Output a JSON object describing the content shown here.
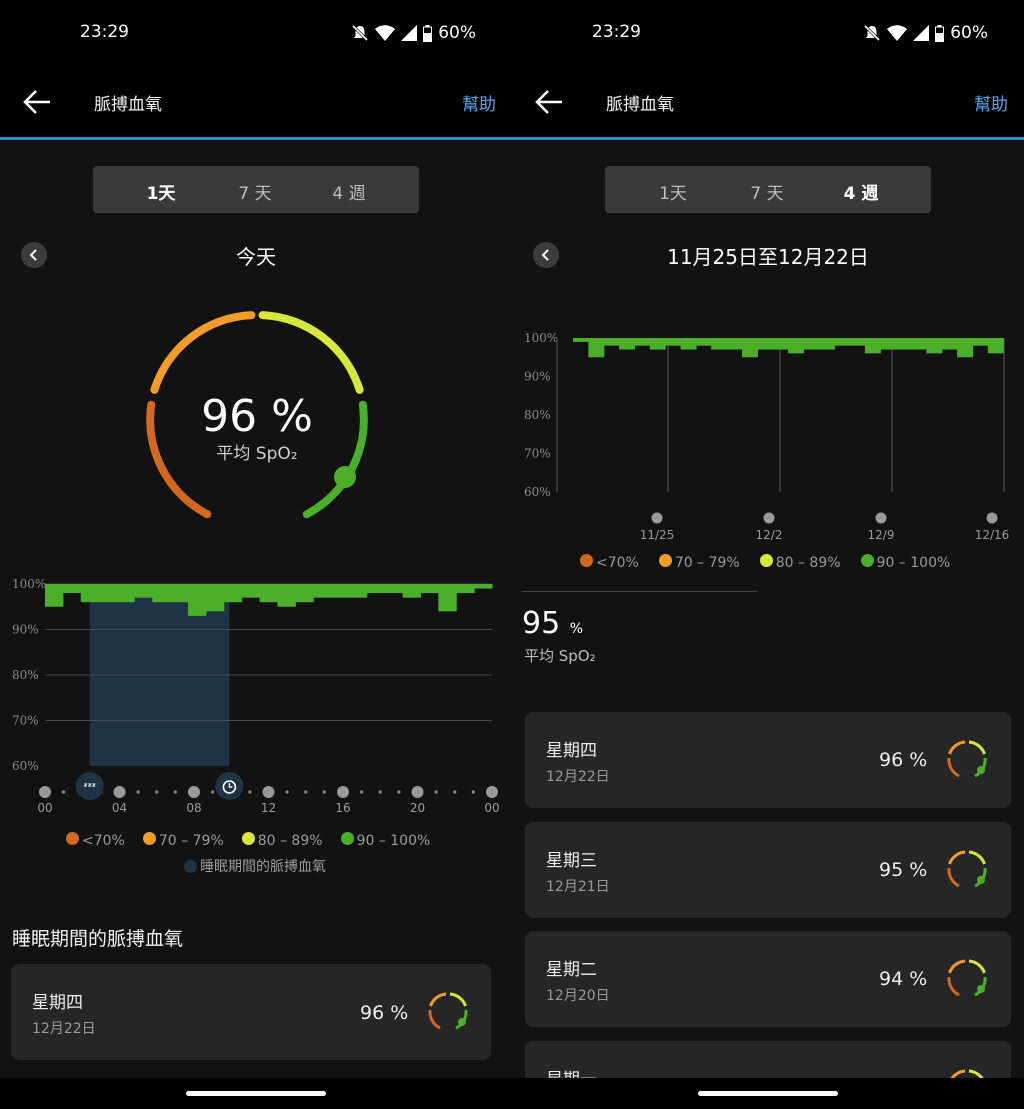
{
  "status": {
    "time": "23:29",
    "battery": "60%"
  },
  "header": {
    "title": "脈搏血氧",
    "help": "幫助"
  },
  "tabs": [
    {
      "label": "1天"
    },
    {
      "label": "7 天"
    },
    {
      "label": "4 週"
    }
  ],
  "left": {
    "period": "今天",
    "gauge": {
      "value": "96 %",
      "label": "平均 SpO₂",
      "level_pct": 96
    },
    "chart_data": {
      "type": "area",
      "y_ticks": [
        "100%",
        "90%",
        "80%",
        "70%",
        "60%"
      ],
      "ylim": [
        60,
        100
      ],
      "x_ticks": [
        "00",
        "04",
        "08",
        "12",
        "16",
        "20",
        "00"
      ],
      "xlim_hours": [
        0,
        24
      ],
      "x_hours": [
        0,
        1,
        2,
        3,
        4,
        5,
        6,
        7,
        8,
        9,
        10,
        11,
        12,
        13,
        14,
        15,
        16,
        17,
        18,
        19,
        20,
        21,
        22,
        23,
        24
      ],
      "values": [
        95,
        98,
        96,
        96,
        96,
        97,
        96,
        96,
        93,
        94,
        96,
        97,
        96,
        95,
        96,
        97,
        97,
        97,
        98,
        98,
        97,
        98,
        94,
        98,
        99
      ],
      "sleep_window_hours": [
        2.4,
        9.9
      ]
    },
    "legend": [
      "<70%",
      "70 – 79%",
      "80 – 89%",
      "90 – 100%"
    ],
    "sleep_legend": "睡眠期間的脈搏血氧",
    "section_title": "睡眠期間的脈搏血氧",
    "cards": [
      {
        "day": "星期四",
        "date": "12月22日",
        "value": "96 %"
      }
    ]
  },
  "right": {
    "period": "11月25日至12月22日",
    "chart_data": {
      "type": "area",
      "y_ticks": [
        "100%",
        "90%",
        "80%",
        "70%",
        "60%"
      ],
      "ylim": [
        60,
        100
      ],
      "x_ticks": [
        "11/25",
        "12/2",
        "12/9",
        "12/16"
      ],
      "values": [
        99,
        95,
        98,
        97,
        98,
        97,
        98,
        97,
        98,
        97,
        97,
        95,
        97,
        97,
        96,
        97,
        97,
        98,
        98,
        96,
        97,
        97,
        97,
        96,
        97,
        95,
        98,
        96
      ],
      "avg_value": "95",
      "avg_unit": "%",
      "avg_label": "平均 SpO₂"
    },
    "legend": [
      "<70%",
      "70 – 79%",
      "80 – 89%",
      "90 – 100%"
    ],
    "cards": [
      {
        "day": "星期四",
        "date": "12月22日",
        "value": "96 %"
      },
      {
        "day": "星期三",
        "date": "12月21日",
        "value": "95 %"
      },
      {
        "day": "星期二",
        "date": "12月20日",
        "value": "94 %"
      },
      {
        "day": "星期一",
        "date": "",
        "value": ""
      }
    ]
  },
  "colors": {
    "lt70": "#d2691e",
    "r70": "#f39c28",
    "r80": "#d7e83a",
    "r90": "#4caf2a",
    "accent": "#2e8fd6"
  }
}
